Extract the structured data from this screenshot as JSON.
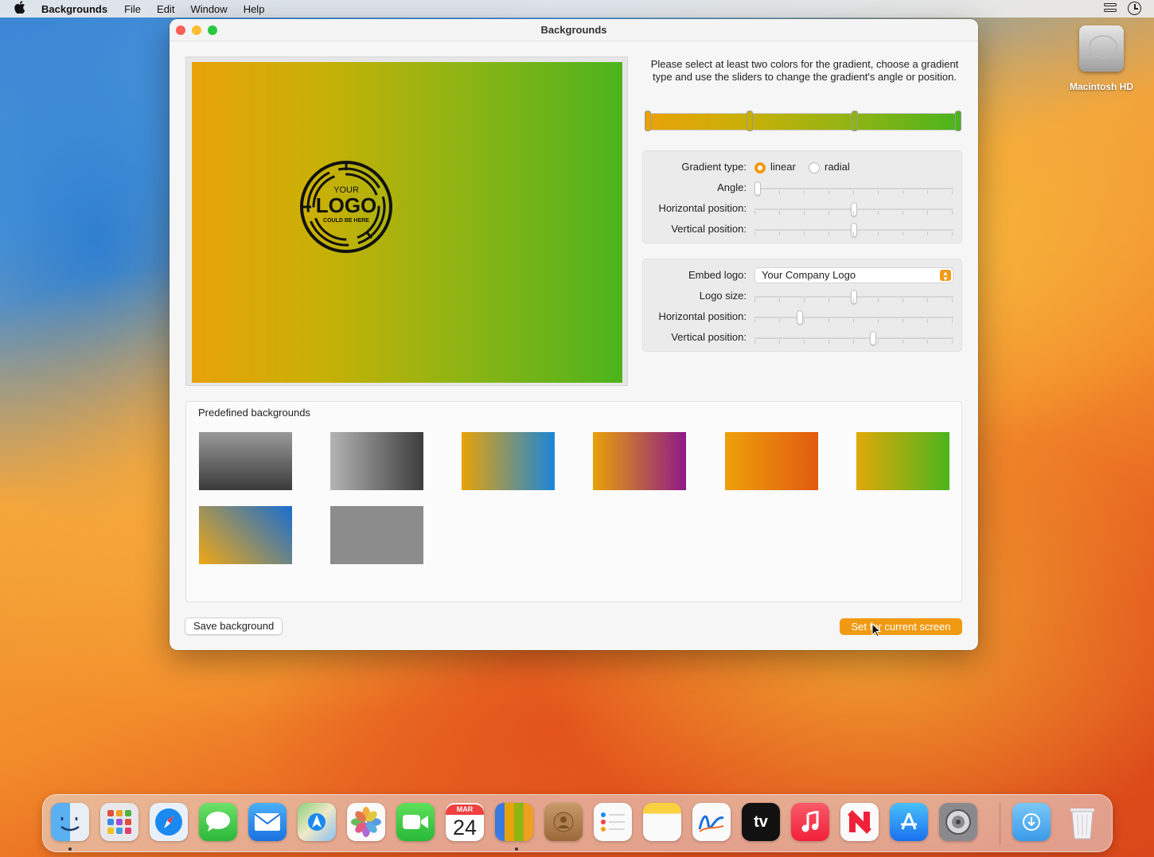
{
  "menubar": {
    "app_name": "Backgrounds",
    "items": [
      "File",
      "Edit",
      "Window",
      "Help"
    ]
  },
  "desktop": {
    "drive_label": "Macintosh HD"
  },
  "window": {
    "title": "Backgrounds",
    "instructions": "Please select at least two colors for the gradient, choose a gradient type and use the sliders to change the gradient's angle or position.",
    "logo_text": {
      "top": "YOUR",
      "main": "LOGO",
      "bottom": "COULD BE HERE"
    },
    "gradient_stops": [
      "#e8a20a",
      "#c8b006",
      "#90b414",
      "#4cb41c"
    ],
    "gradient": {
      "type_label": "Gradient type:",
      "linear_label": "linear",
      "radial_label": "radial",
      "selected_type": "linear",
      "angle_label": "Angle:",
      "hpos_label": "Horizontal position:",
      "vpos_label": "Vertical position:",
      "angle_value": 0.0,
      "hpos_value": 0.5,
      "vpos_value": 0.5
    },
    "logo": {
      "embed_label": "Embed logo:",
      "embed_value": "Your Company Logo",
      "size_label": "Logo size:",
      "hpos_label": "Horizontal position:",
      "vpos_label": "Vertical position:",
      "size_value": 0.5,
      "hpos_value": 0.22,
      "vpos_value": 0.6
    },
    "predefined": {
      "title": "Predefined backgrounds",
      "items": [
        [
          "#9a9a9a",
          "#3a3a3a"
        ],
        [
          "#b4b4b4",
          "#3c3c3c"
        ],
        [
          "#e8a20a",
          "#1a86d8"
        ],
        [
          "#e8a20a",
          "#8e1a86"
        ],
        [
          "#eea00a",
          "#e25a10"
        ],
        [
          "#e0a80a",
          "#4cb41c"
        ],
        [
          "#f0a814",
          "#1a6ed0"
        ],
        [
          "#8c8c8c",
          "#8c8c8c"
        ]
      ]
    },
    "save_button": "Save background",
    "set_button": "Set for current screen"
  },
  "dock": {
    "apps": [
      "Finder",
      "Launchpad",
      "Safari",
      "Messages",
      "Mail",
      "Maps",
      "Photos",
      "FaceTime",
      "Calendar",
      "Backgrounds",
      "Contacts",
      "Reminders",
      "Notes",
      "Freeform",
      "TV",
      "Music",
      "News",
      "App Store",
      "System Settings",
      "Downloads",
      "Trash"
    ],
    "calendar_month": "MAR",
    "calendar_day": "24",
    "tv_label": "tv"
  }
}
